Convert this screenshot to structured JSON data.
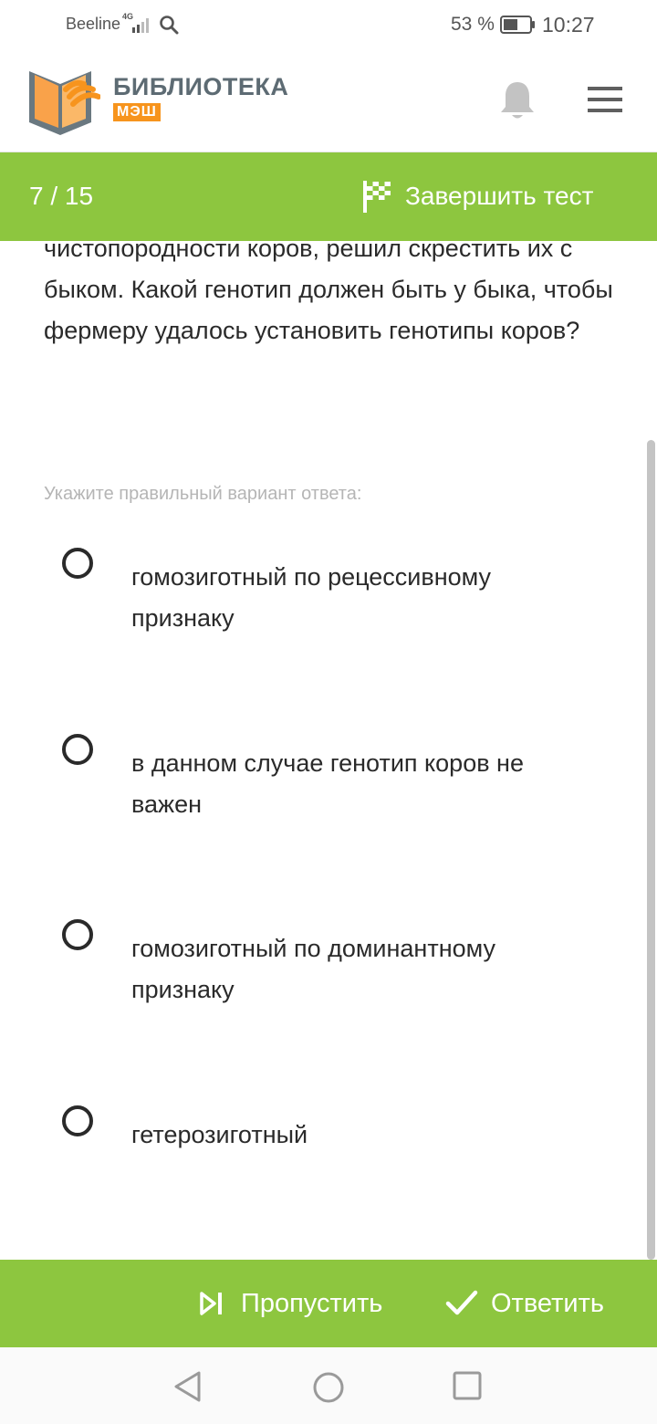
{
  "status_bar": {
    "carrier": "Beeline",
    "network": "4G",
    "battery_percent": "53 %",
    "time": "10:27"
  },
  "header": {
    "logo_title": "БИБЛИОТЕКА",
    "logo_subtitle": "МЭШ",
    "icons": [
      "bell-icon",
      "menu-icon"
    ]
  },
  "test_bar": {
    "counter": "7 / 15",
    "finish_label": "Завершить тест",
    "finish_icon": "checkered-flag-icon"
  },
  "question": {
    "text": "чистопородности коров, решил скрестить их с быком. Какой генотип должен быть у быка, чтобы фермеру удалось установить генотипы коров?"
  },
  "hint": "Укажите правильный вариант ответа:",
  "options": [
    {
      "label": "гомозиготный по рецессивному признаку"
    },
    {
      "label": "в данном случае генотип коров не важен"
    },
    {
      "label": "гомозиготный по доминантному признаку"
    },
    {
      "label": "гетерозиготный"
    }
  ],
  "actions": {
    "skip_label": "Пропустить",
    "answer_label": "Ответить"
  },
  "colors": {
    "accent_green": "#8dc63f",
    "logo_orange": "#f7941d",
    "logo_gray": "#5d6b73"
  }
}
